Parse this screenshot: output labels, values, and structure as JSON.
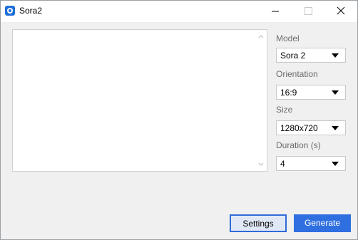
{
  "window": {
    "title": "Sora2"
  },
  "controls": {
    "model": {
      "label": "Model",
      "value": "Sora 2"
    },
    "orientation": {
      "label": "Orientation",
      "value": "16:9"
    },
    "size": {
      "label": "Size",
      "value": "1280x720"
    },
    "duration": {
      "label": "Duration (s)",
      "value": "4"
    }
  },
  "buttons": {
    "settings": "Settings",
    "generate": "Generate"
  },
  "colors": {
    "accent": "#2f6fe0",
    "window_bg": "#f0f0f0",
    "label_gray": "#6b6b6b"
  }
}
